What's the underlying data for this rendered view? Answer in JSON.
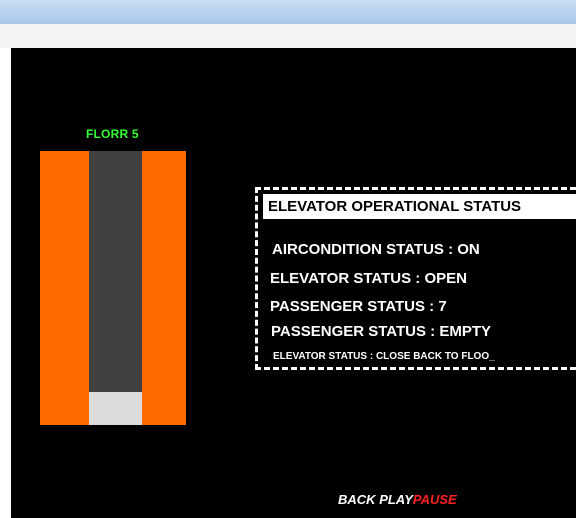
{
  "floor": {
    "label": "FLORR 5"
  },
  "status_panel": {
    "title": "ELEVATOR OPERATIONAL STATUS",
    "lines": [
      "AIRCONDITION STATUS : ON",
      "ELEVATOR STATUS : OPEN",
      "PASSENGER STATUS : 7",
      "PASSENGER STATUS : EMPTY",
      "ELEVATOR STATUS : CLOSE BACK TO FLOO_"
    ]
  },
  "controls": {
    "back": "BACK",
    "play": "PLAY",
    "pause": "PAUSE"
  },
  "colors": {
    "door": "#ff6a00",
    "shaft": "#404040",
    "car": "#dcdcdc",
    "floor_label": "#33ff33",
    "pause": "#ff2020",
    "background": "#000000"
  }
}
